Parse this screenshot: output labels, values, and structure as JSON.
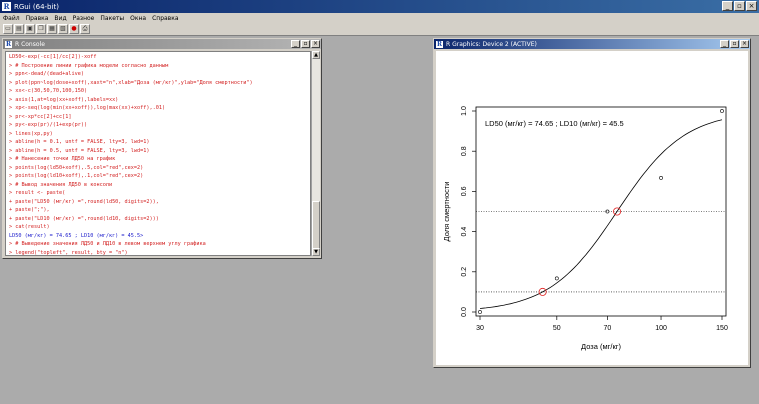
{
  "app": {
    "title": "RGui (64-bit)",
    "icon": "R"
  },
  "window_buttons": {
    "minimize": "_",
    "restore": "▫",
    "close": "×"
  },
  "menu": [
    "Файл",
    "Правка",
    "Вид",
    "Разное",
    "Пакеты",
    "Окна",
    "Справка"
  ],
  "toolbar": [
    "open-script-icon",
    "load-workspace-icon",
    "save-workspace-icon",
    "copy-icon",
    "paste-icon",
    "copy-paste-icon",
    "stop-icon",
    "print-icon"
  ],
  "console": {
    "title": "R Console",
    "lines": [
      {
        "t": "LD50<-exp(-cc[1]/cc[2])-xoff",
        "c": "red"
      },
      {
        "t": "> # Построение линии графика модели согласно данным",
        "c": "red"
      },
      {
        "t": "> ppn<-dead/(dead+alive)",
        "c": "red"
      },
      {
        "t": "> plot(ppn~log(dose+xoff),xaxt=\"n\",xlab=\"Доза (мг/кг)\",ylab=\"Доля смертности\")",
        "c": "red"
      },
      {
        "t": "> xx<-c(30,50,70,100,150)",
        "c": "red"
      },
      {
        "t": "> axis(1,at=log(xx+xoff),labels=xx)",
        "c": "red"
      },
      {
        "t": "> xp<-seq(log(min(xx+xoff)),log(max(xx)+xoff),.01)",
        "c": "red"
      },
      {
        "t": "> pr<-xp*cc[2]+cc[1]",
        "c": "red"
      },
      {
        "t": "> py<-exp(pr)/(1+exp(pr))",
        "c": "red"
      },
      {
        "t": "> lines(xp,py)",
        "c": "red"
      },
      {
        "t": "> abline(h = 0.1, untf = FALSE, lty=3, lwd=1)",
        "c": "red"
      },
      {
        "t": "> abline(h = 0.5, untf = FALSE, lty=3, lwd=1)",
        "c": "red"
      },
      {
        "t": "> # Нанесение точки ЛД50 на график",
        "c": "red"
      },
      {
        "t": "> points(log(ld50+xoff),.5,col=\"red\",cex=2)",
        "c": "red"
      },
      {
        "t": "> points(log(ld10+xoff),.1,col=\"red\",cex=2)",
        "c": "red"
      },
      {
        "t": "> # Вывод значения ЛД50 в консоли",
        "c": "red"
      },
      {
        "t": "> result <- paste(",
        "c": "red"
      },
      {
        "t": "+ paste(\"LD50 (мг/кг) =\",round(ld50, digits=2)),",
        "c": "red"
      },
      {
        "t": "+ paste(\";\"),",
        "c": "red"
      },
      {
        "t": "+ paste(\"LD10 (мг/кг) =\",round(ld10, digits=2)))",
        "c": "red"
      },
      {
        "t": "> cat(result)",
        "c": "red"
      },
      {
        "t": "LD50 (мг/кг) = 74.65 ; LD10 (мг/кг) = 45.5>",
        "c": "blue"
      },
      {
        "t": "> # Выведение значения ЛД50 и ЛД10 в левом верхнем углу графика",
        "c": "red"
      },
      {
        "t": "> legend(\"topleft\", result, bty = \"n\")",
        "c": "red"
      },
      {
        "t": "> |",
        "c": "red"
      }
    ]
  },
  "graphics": {
    "title": "R Graphics: Device 2 (ACTIVE)"
  },
  "chart_data": {
    "type": "scatter",
    "legend_text": "LD50 (мг/кг) = 74.65 ; LD10 (мг/кг) = 45.5",
    "legend_position": "top-left",
    "xlabel": "Доза (мг/кг)",
    "ylabel": "Доля смертности",
    "x_scale": "log",
    "x_ticks": [
      30,
      50,
      70,
      100,
      150
    ],
    "y_ticks": [
      "0.0",
      "0.2",
      "0.4",
      "0.6",
      "0.8",
      "1.0"
    ],
    "y_tick_values": [
      0,
      0.2,
      0.4,
      0.6,
      0.8,
      1.0
    ],
    "ylim": [
      0,
      1
    ],
    "points": [
      {
        "x": 30,
        "y": 0.0
      },
      {
        "x": 50,
        "y": 0.167
      },
      {
        "x": 70,
        "y": 0.5
      },
      {
        "x": 100,
        "y": 0.667
      },
      {
        "x": 150,
        "y": 1.0
      }
    ],
    "red_points": [
      {
        "x": 45.5,
        "y": 0.1
      },
      {
        "x": 74.65,
        "y": 0.5
      }
    ],
    "hlines": [
      0.1,
      0.5
    ],
    "curve": {
      "type": "logistic",
      "midpoint": 74.65,
      "p10": 45.5
    }
  }
}
